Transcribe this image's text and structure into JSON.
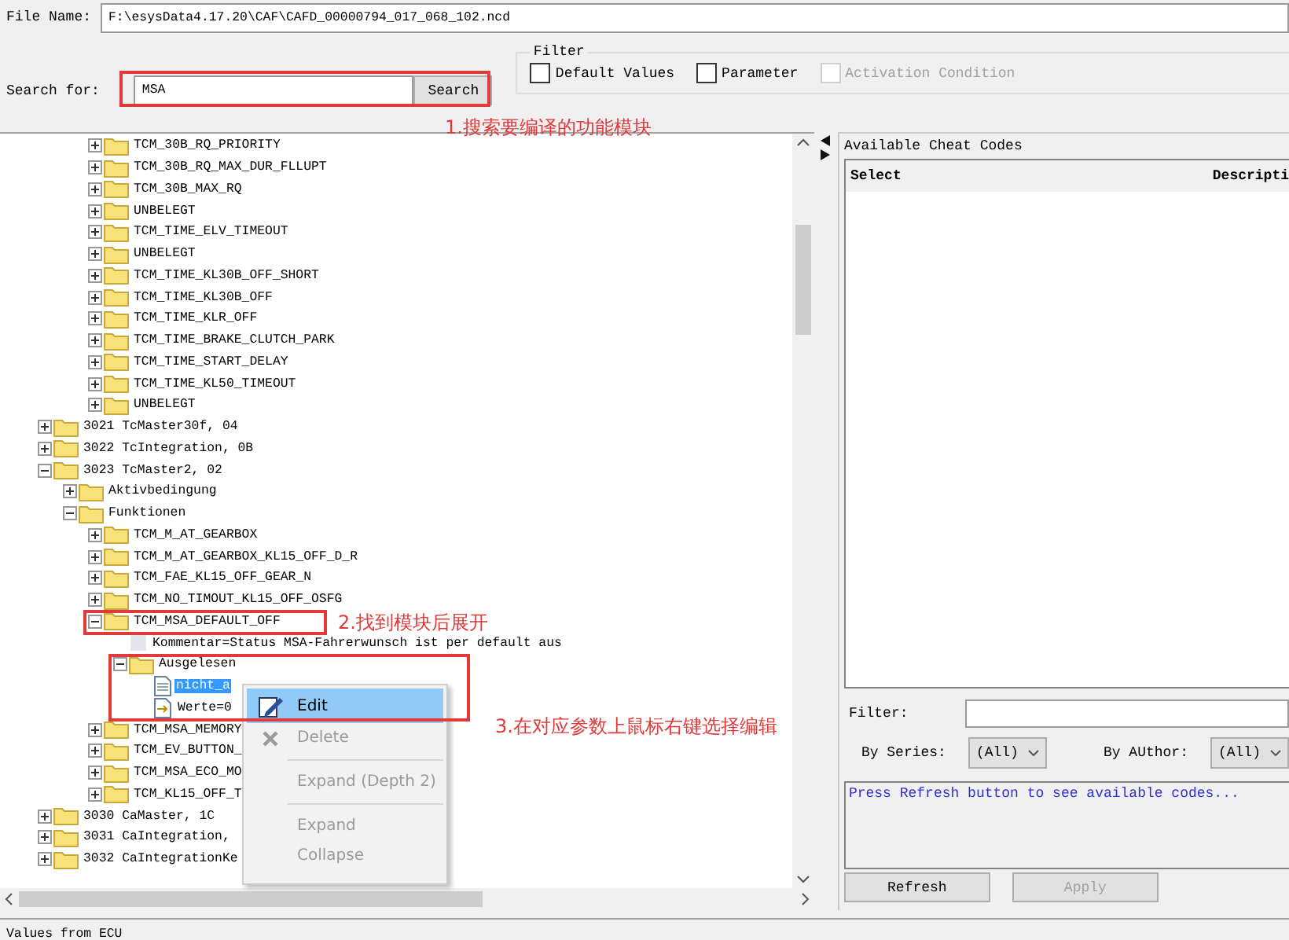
{
  "file_name": {
    "label": "File Name:",
    "value": "F:\\esysData4.17.20\\CAF\\CAFD_00000794_017_068_102.ncd"
  },
  "search": {
    "label": "Search for:",
    "value": "MSA",
    "button": "Search"
  },
  "filter": {
    "title": "Filter",
    "options": [
      {
        "label": "Default Values",
        "checked": false,
        "disabled": false
      },
      {
        "label": "Parameter",
        "checked": false,
        "disabled": false
      },
      {
        "label": "Activation Condition",
        "checked": false,
        "disabled": true
      }
    ]
  },
  "tree": {
    "continued_items": [
      {
        "label": "TCM_30B_RQ_PRIORITY",
        "kind": "folder",
        "expanded": false,
        "selected": false
      },
      {
        "label": "TCM_30B_RQ_MAX_DUR_FLLUPT",
        "kind": "folder",
        "expanded": false,
        "selected": false
      },
      {
        "label": "TCM_30B_MAX_RQ",
        "kind": "folder",
        "expanded": false,
        "selected": false
      },
      {
        "label": "UNBELEGT",
        "kind": "folder",
        "expanded": false,
        "selected": false
      },
      {
        "label": "TCM_TIME_ELV_TIMEOUT",
        "kind": "folder",
        "expanded": false,
        "selected": false
      },
      {
        "label": "UNBELEGT",
        "kind": "folder",
        "expanded": false,
        "selected": false
      },
      {
        "label": "TCM_TIME_KL30B_OFF_SHORT",
        "kind": "folder",
        "expanded": false,
        "selected": false
      },
      {
        "label": "TCM_TIME_KL30B_OFF",
        "kind": "folder",
        "expanded": false,
        "selected": false
      },
      {
        "label": "TCM_TIME_KLR_OFF",
        "kind": "folder",
        "expanded": false,
        "selected": false
      },
      {
        "label": "TCM_TIME_BRAKE_CLUTCH_PARK",
        "kind": "folder",
        "expanded": false,
        "selected": false
      },
      {
        "label": "TCM_TIME_START_DELAY",
        "kind": "folder",
        "expanded": false,
        "selected": false
      },
      {
        "label": "TCM_TIME_KL50_TIMEOUT",
        "kind": "folder",
        "expanded": false,
        "selected": false
      },
      {
        "label": "UNBELEGT",
        "kind": "folder",
        "expanded": false,
        "selected": false
      }
    ],
    "nodes": [
      {
        "label": "3021 TcMaster30f, 04",
        "kind": "folder",
        "expanded": false,
        "selected": false
      },
      {
        "label": "3022 TcIntegration, 0B",
        "kind": "folder",
        "expanded": false,
        "selected": false
      },
      {
        "label": "3023 TcMaster2, 02",
        "kind": "folder",
        "expanded": true,
        "selected": false,
        "children": [
          {
            "label": "Aktivbedingung",
            "kind": "folder",
            "expanded": false,
            "selected": false
          },
          {
            "label": "Funktionen",
            "kind": "folder",
            "expanded": true,
            "selected": false,
            "children": [
              {
                "label": "TCM_M_AT_GEARBOX",
                "kind": "folder",
                "expanded": false,
                "selected": false
              },
              {
                "label": "TCM_M_AT_GEARBOX_KL15_OFF_D_R",
                "kind": "folder",
                "expanded": false,
                "selected": false
              },
              {
                "label": "TCM_FAE_KL15_OFF_GEAR_N",
                "kind": "folder",
                "expanded": false,
                "selected": false
              },
              {
                "label": "TCM_NO_TIMOUT_KL15_OFF_OSFG",
                "kind": "folder",
                "expanded": false,
                "selected": false
              },
              {
                "label": "TCM_MSA_DEFAULT_OFF",
                "kind": "folder",
                "expanded": true,
                "selected": false,
                "children": [
                  {
                    "label": "Kommentar=Status MSA-Fahrerwunsch ist per default aus",
                    "kind": "comment",
                    "selected": false
                  },
                  {
                    "label": "Ausgelesen",
                    "kind": "folder",
                    "expanded": true,
                    "selected": false,
                    "children": [
                      {
                        "label": "nicht_a",
                        "kind": "param",
                        "selected": true
                      },
                      {
                        "label": "Werte=0",
                        "kind": "value",
                        "selected": false
                      }
                    ]
                  }
                ]
              },
              {
                "label": "TCM_MSA_MEMORY",
                "kind": "folder",
                "expanded": false,
                "selected": false
              },
              {
                "label": "TCM_EV_BUTTON_",
                "kind": "folder",
                "expanded": false,
                "selected": false
              },
              {
                "label": "TCM_MSA_ECO_MO",
                "kind": "folder",
                "expanded": false,
                "selected": false
              },
              {
                "label": "TCM_KL15_OFF_T",
                "kind": "folder",
                "expanded": false,
                "selected": false
              }
            ]
          }
        ]
      },
      {
        "label": "3030 CaMaster, 1C",
        "kind": "folder",
        "expanded": false,
        "selected": false
      },
      {
        "label": "3031 CaIntegration,",
        "kind": "folder",
        "expanded": false,
        "selected": false
      },
      {
        "label": "3032 CaIntegrationKe",
        "kind": "folder",
        "expanded": false,
        "selected": false
      }
    ]
  },
  "context_menu": {
    "items": [
      {
        "kind": "edit",
        "label": "Edit",
        "selected": true,
        "disabled": false
      },
      {
        "kind": "delete",
        "label": "Delete",
        "selected": false,
        "disabled": true
      },
      {
        "kind": "separator"
      },
      {
        "kind": "item",
        "label": "Expand (Depth 2)",
        "selected": false,
        "disabled": true
      },
      {
        "kind": "separator"
      },
      {
        "kind": "item",
        "label": "Expand",
        "selected": false,
        "disabled": true
      },
      {
        "kind": "item",
        "label": "Collapse",
        "selected": false,
        "disabled": true
      }
    ]
  },
  "cheat_codes": {
    "title": "Available Cheat Codes",
    "columns": [
      "Select",
      "Descripti"
    ],
    "filter_label": "Filter:",
    "series_label": "By Series:",
    "series_value": "(All)",
    "author_label": "By AUthor:",
    "author_value": "(All)",
    "message": "Press Refresh button to see available codes...",
    "buttons": [
      {
        "label": "Refresh",
        "disabled": false
      },
      {
        "label": "Apply",
        "disabled": true
      }
    ]
  },
  "status_bar": "Values from ECU",
  "annotations": [
    {
      "text": "1.搜索要编译的功能模块"
    },
    {
      "text": "2.找到模块后展开"
    },
    {
      "text": "3.在对应参数上鼠标右键选择编辑"
    }
  ]
}
